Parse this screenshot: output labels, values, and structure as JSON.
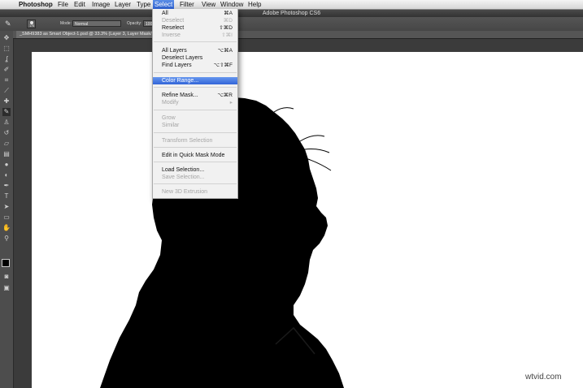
{
  "menubar": {
    "apple": "",
    "app": "Photoshop",
    "items": [
      "File",
      "Edit",
      "Image",
      "Layer",
      "Type",
      "Select",
      "Filter",
      "View",
      "Window",
      "Help"
    ]
  },
  "window": {
    "title": "Adobe Photoshop CS6"
  },
  "options": {
    "brush_size": "175",
    "mode_label": "Mode:",
    "mode_value": "Normal",
    "opacity_label": "Opacity:",
    "opacity_value": "100%"
  },
  "document": {
    "tab_title": "_SMH9383 as Smart Object-1.psd @ 33.3% (Layer 3, Layer Mask/8)"
  },
  "select_menu": {
    "items": [
      {
        "label": "All",
        "shortcut": "⌘A",
        "disabled": false
      },
      {
        "label": "Deselect",
        "shortcut": "⌘D",
        "disabled": true
      },
      {
        "label": "Reselect",
        "shortcut": "⇧⌘D",
        "disabled": false
      },
      {
        "label": "Inverse",
        "shortcut": "⇧⌘I",
        "disabled": true
      },
      {
        "label": "All Layers",
        "shortcut": "⌥⌘A",
        "disabled": false
      },
      {
        "label": "Deselect Layers",
        "shortcut": "",
        "disabled": false
      },
      {
        "label": "Find Layers",
        "shortcut": "⌥⇧⌘F",
        "disabled": false
      },
      {
        "label": "Color Range...",
        "shortcut": "",
        "disabled": false,
        "highlighted": true
      },
      {
        "label": "Refine Mask...",
        "shortcut": "⌥⌘R",
        "disabled": false
      },
      {
        "label": "Modify",
        "shortcut": "▸",
        "disabled": true
      },
      {
        "label": "Grow",
        "shortcut": "",
        "disabled": true
      },
      {
        "label": "Similar",
        "shortcut": "",
        "disabled": true
      },
      {
        "label": "Transform Selection",
        "shortcut": "",
        "disabled": true
      },
      {
        "label": "Edit in Quick Mask Mode",
        "shortcut": "",
        "disabled": false
      },
      {
        "label": "Load Selection...",
        "shortcut": "",
        "disabled": false
      },
      {
        "label": "Save Selection...",
        "shortcut": "",
        "disabled": true
      },
      {
        "label": "New 3D Extrusion",
        "shortcut": "",
        "disabled": true
      }
    ]
  },
  "tools": [
    "move-tool",
    "marquee-tool",
    "lasso-tool",
    "quick-selection-tool",
    "crop-tool",
    "eyedropper-tool",
    "healing-brush-tool",
    "brush-tool",
    "clone-stamp-tool",
    "history-brush-tool",
    "eraser-tool",
    "gradient-tool",
    "blur-tool",
    "dodge-tool",
    "pen-tool",
    "type-tool",
    "path-selection-tool",
    "shape-tool",
    "hand-tool",
    "zoom-tool"
  ],
  "watermark": "wtvid.com",
  "colors": {
    "highlight": "#3366d8",
    "silhouette": "#000000",
    "canvas": "#ffffff"
  }
}
